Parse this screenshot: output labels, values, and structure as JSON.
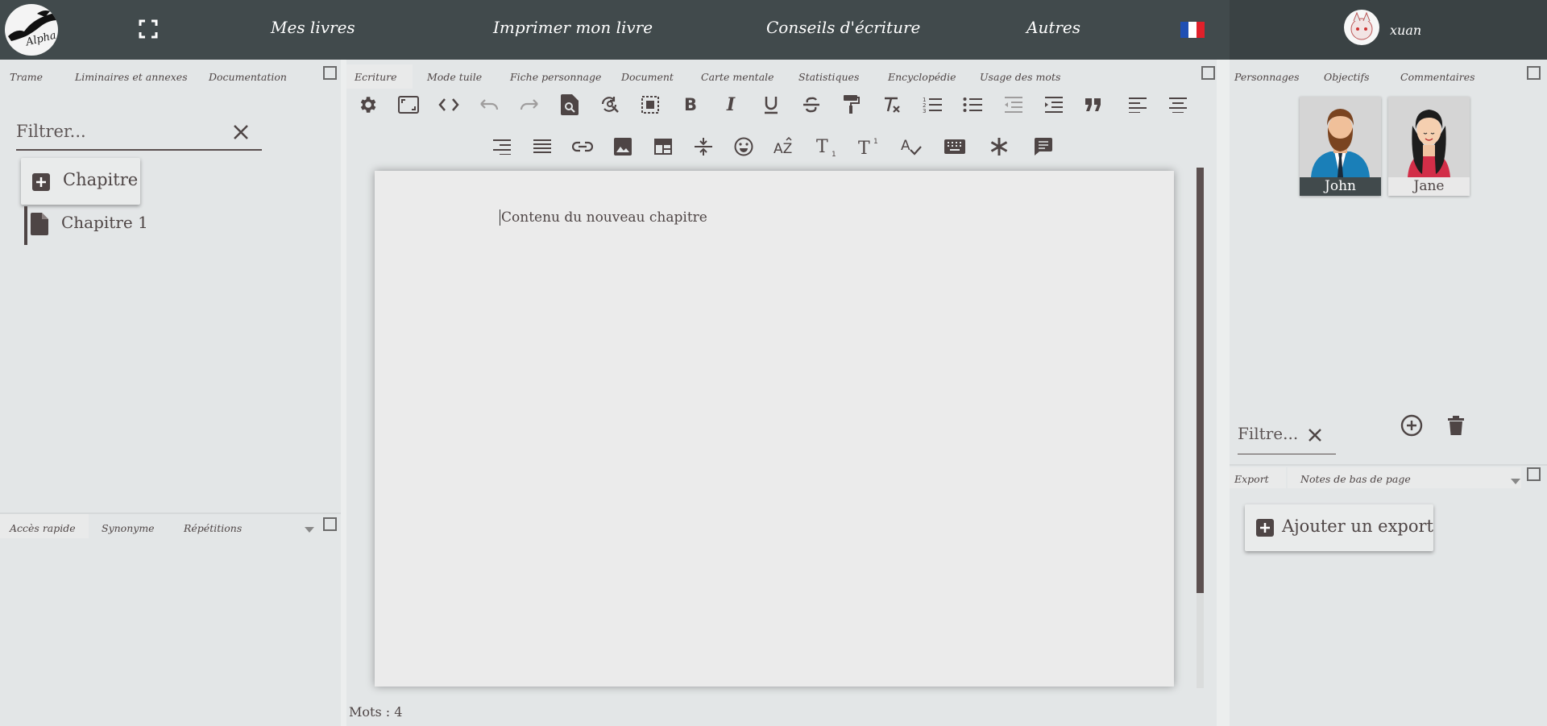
{
  "header": {
    "logo_text": "Alpha",
    "nav": [
      "Mes livres",
      "Imprimer mon livre",
      "Conseils d'écriture",
      "Autres"
    ],
    "username": "xuan",
    "flag_colors": [
      "#1f4fb3",
      "#ffffff",
      "#e0202a"
    ]
  },
  "left_panel": {
    "tabs": [
      "Trame",
      "Liminaires et annexes",
      "Documentation"
    ],
    "filter_placeholder": "Filtrer...",
    "add_chapter_label": "Chapitre",
    "chapters": [
      "Chapitre 1"
    ],
    "bottom_tabs": [
      "Accès rapide",
      "Synonyme",
      "Répétitions"
    ]
  },
  "center": {
    "tabs": [
      "Ecriture",
      "Mode tuile",
      "Fiche personnage",
      "Document",
      "Carte mentale",
      "Statistiques",
      "Encyclopédie",
      "Usage des mots"
    ],
    "toolbar_row1": [
      "settings-icon",
      "fullscreen-editor-icon",
      "source-code-icon",
      "undo-icon",
      "redo-icon",
      "preview-icon",
      "find-replace-icon",
      "select-all-icon",
      "bold-icon",
      "italic-icon",
      "underline-icon",
      "strikethrough-icon",
      "format-painter-icon",
      "clear-format-icon",
      "numbered-list-icon",
      "bullet-list-icon",
      "outdent-icon",
      "indent-icon",
      "blockquote-icon",
      "align-left-icon",
      "align-center-icon"
    ],
    "toolbar_row2": [
      "align-right-icon",
      "align-justify-icon",
      "link-icon",
      "image-icon",
      "table-icon",
      "page-break-icon",
      "emoji-icon",
      "sort-icon",
      "subscript-icon",
      "superscript-icon",
      "spellcheck-icon",
      "keyboard-icon",
      "asterisk-icon",
      "comment-icon"
    ],
    "editor_text": "Contenu du nouveau chapitre",
    "word_count": "Mots : 4"
  },
  "right_panel": {
    "tabs": [
      "Personnages",
      "Objectifs",
      "Commentaires"
    ],
    "characters": [
      {
        "name": "John"
      },
      {
        "name": "Jane"
      }
    ],
    "filter_placeholder": "Filtre...",
    "export_tabs": [
      "Export",
      "Notes de bas de page"
    ],
    "add_export_label": "Ajouter un export"
  }
}
